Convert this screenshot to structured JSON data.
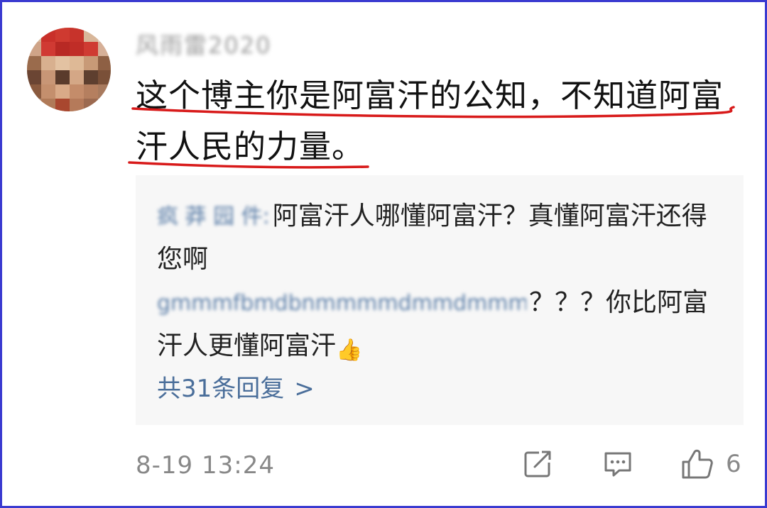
{
  "comment": {
    "username": "风雨雷2020",
    "text": "这个博主你是阿富汗的公知，不知道阿富汗人民的力量。",
    "timestamp": "8-19 13:24",
    "like_count": "6"
  },
  "replies": [
    {
      "username": "疯 莽 园 件:",
      "text": "阿富汗人哪懂阿富汗？真懂阿富汗还得您啊"
    },
    {
      "username": "gmmmfbmdbnmmmmdmmdmmml:",
      "text": "？？？你比阿富汗人更懂阿富汗",
      "emoji": "👍"
    }
  ],
  "more_replies_label": "共31条回复",
  "more_replies_chevron": ">",
  "icons": {
    "edit": "edit-icon",
    "comment": "comment-icon",
    "like": "thumbs-up-icon"
  },
  "colors": {
    "frame": "#3a3ad0",
    "underline": "#d81a1a",
    "link": "#4a6e9a",
    "reply_bg": "#f7f7f7"
  }
}
